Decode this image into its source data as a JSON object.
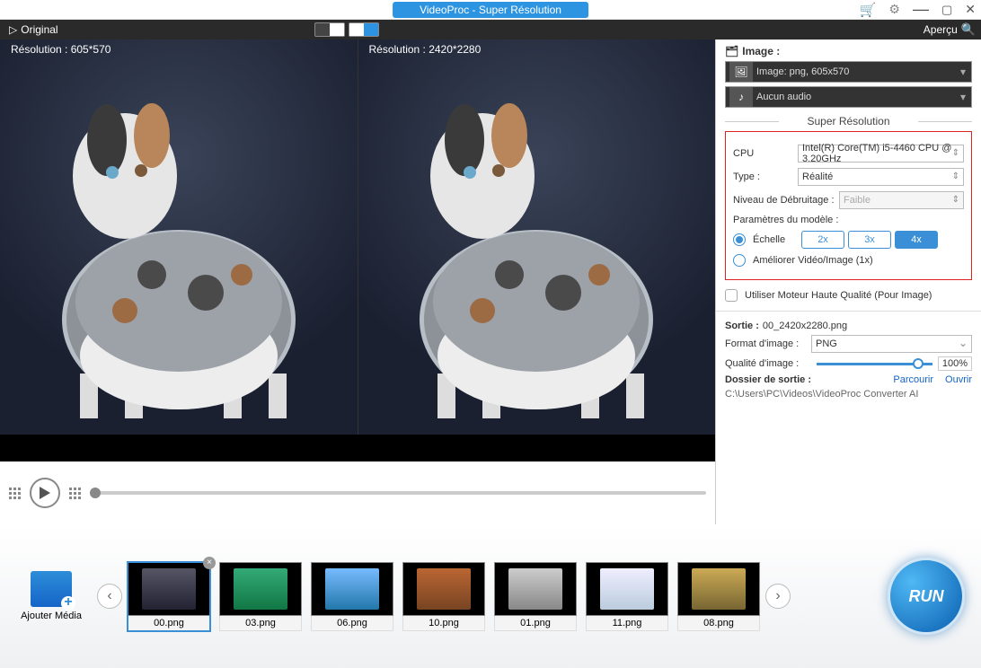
{
  "app": {
    "title": "VideoProc  -  Super Résolution"
  },
  "toolstrip": {
    "original": "Original",
    "apercu": "Aperçu"
  },
  "preview": {
    "left_label": "Résolution : 605*570",
    "right_label": "Résolution : 2420*2280"
  },
  "side": {
    "image_header": "Image :",
    "image_info": "Image: png, 605x570",
    "audio_info": "Aucun audio",
    "section": "Super Résolution",
    "cpu_label": "CPU",
    "cpu_value": "Intel(R) Core(TM) i5-4460 CPU @ 3.20GHz",
    "type_label": "Type :",
    "type_value": "Réalité",
    "denoise_label": "Niveau de Débruitage :",
    "denoise_value": "Faible",
    "model_label": "Paramètres du modèle :",
    "scale_label": "Échelle",
    "scale_2x": "2x",
    "scale_3x": "3x",
    "scale_4x": "4x",
    "enhance_label": "Améliorer Vidéo/Image (1x)",
    "hq_label": "Utiliser Moteur Haute Qualité (Pour Image)",
    "sortie_label": "Sortie :",
    "sortie_value": "00_2420x2280.png",
    "format_label": "Format d'image :",
    "format_value": "PNG",
    "quality_label": "Qualité d'image :",
    "quality_pct": "100%",
    "folder_label": "Dossier de sortie :",
    "browse": "Parcourir",
    "open": "Ouvrir",
    "path": "C:\\Users\\PC\\Videos\\VideoProc Converter AI"
  },
  "bottom": {
    "add_label": "Ajouter Média",
    "run": "RUN",
    "thumbs": [
      {
        "name": "00.png"
      },
      {
        "name": "03.png"
      },
      {
        "name": "06.png"
      },
      {
        "name": "10.png"
      },
      {
        "name": "01.png"
      },
      {
        "name": "11.png"
      },
      {
        "name": "08.png"
      }
    ]
  }
}
